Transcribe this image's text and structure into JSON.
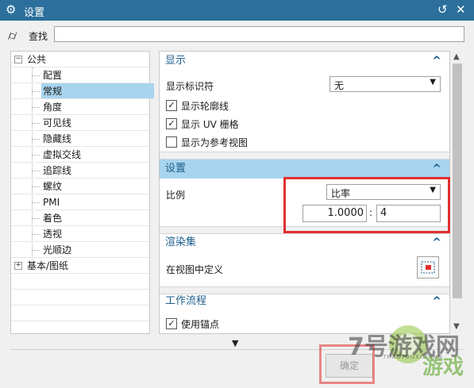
{
  "window": {
    "title": "设置",
    "icons": [
      "gear-icon",
      "reset-icon",
      "close-icon"
    ]
  },
  "search": {
    "label": "查找",
    "value": "",
    "placeholder": ""
  },
  "tree": {
    "root_public": "公共",
    "children": [
      "配置",
      "常规",
      "角度",
      "可见线",
      "隐藏线",
      "虚拟交线",
      "追踪线",
      "螺纹",
      "PMI",
      "着色",
      "透视",
      "光顺边"
    ],
    "selected": "常规",
    "root_basic": "基本/图纸"
  },
  "sections": {
    "display": {
      "title": "显示",
      "marker_label": "显示标识符",
      "marker_value": "无",
      "checkboxes": [
        {
          "label": "显示轮廓线",
          "checked": true
        },
        {
          "label": "显示 UV 栅格",
          "checked": true
        },
        {
          "label": "显示为参考视图",
          "checked": false
        }
      ]
    },
    "settings": {
      "title": "设置",
      "scale_label": "比例",
      "scale_mode": "比率",
      "numerator": "1.0000",
      "separator": ":",
      "denominator": "4"
    },
    "render_set": {
      "title": "渲染集",
      "define_label": "在视图中定义"
    },
    "workflow": {
      "title": "工作流程",
      "anchor_label": "使用锚点",
      "anchor_checked": true
    }
  },
  "footer": {
    "ok_label": "确定"
  },
  "watermark": {
    "text": "7号游戏网",
    "sub": "游戏",
    "pinyin": "7HAOYOUXIWANG"
  },
  "colors": {
    "titlebar": "#2c6f9c",
    "section_title": "#1d5e8c",
    "selection": "#a8d4ee",
    "callout": "#e03030"
  }
}
